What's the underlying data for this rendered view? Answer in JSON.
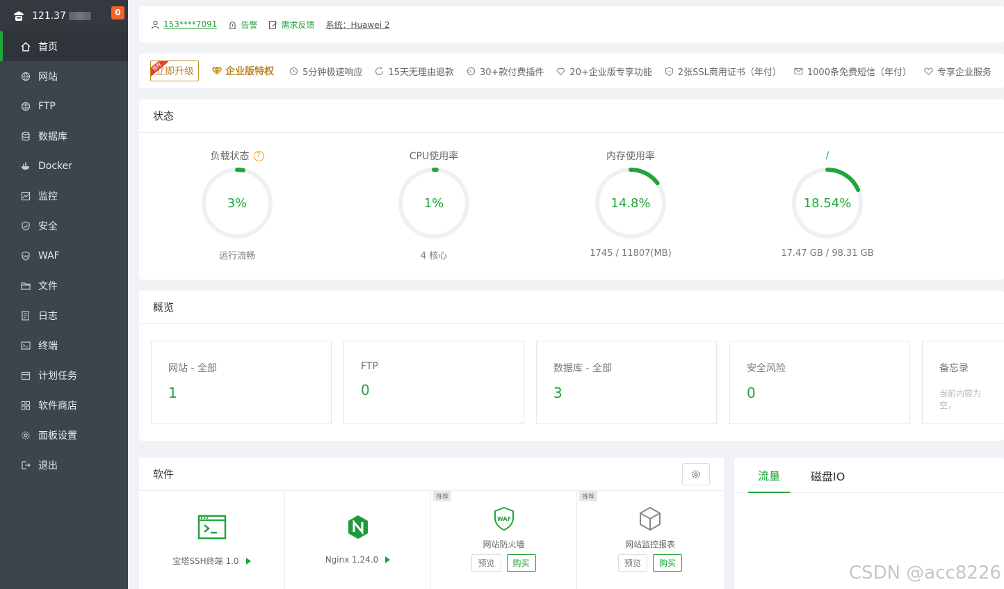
{
  "sidebar": {
    "ip": "121.37",
    "badge": "0",
    "items": [
      {
        "label": "首页",
        "icon": "home-icon"
      },
      {
        "label": "网站",
        "icon": "globe-icon"
      },
      {
        "label": "FTP",
        "icon": "ftp-icon"
      },
      {
        "label": "数据库",
        "icon": "database-icon"
      },
      {
        "label": "Docker",
        "icon": "docker-icon"
      },
      {
        "label": "监控",
        "icon": "monitor-icon"
      },
      {
        "label": "安全",
        "icon": "shield-icon"
      },
      {
        "label": "WAF",
        "icon": "waf-icon"
      },
      {
        "label": "文件",
        "icon": "folder-icon"
      },
      {
        "label": "日志",
        "icon": "log-icon"
      },
      {
        "label": "终端",
        "icon": "terminal-icon"
      },
      {
        "label": "计划任务",
        "icon": "calendar-icon"
      },
      {
        "label": "软件商店",
        "icon": "apps-icon"
      },
      {
        "label": "面板设置",
        "icon": "gear-icon"
      },
      {
        "label": "退出",
        "icon": "logout-icon"
      }
    ]
  },
  "topbar": {
    "user": "153****7091",
    "alarm": "告警",
    "feedback": "需求反馈",
    "system": "系统：Huawei 2"
  },
  "promo": {
    "ribbon": "推荐",
    "upgrade": "立即升级",
    "enterprise": "企业版特权",
    "features": [
      "5分钟极速响应",
      "15天无理由退款",
      "30+款付费插件",
      "20+企业版专享功能",
      "2张SSL商用证书（年付）",
      "1000条免费短信（年付）",
      "专享企业服务"
    ]
  },
  "status": {
    "title": "状态",
    "gauges": [
      {
        "label": "负载状态",
        "value": "3%",
        "percent": 3,
        "sub": "运行流畅"
      },
      {
        "label": "CPU使用率",
        "value": "1%",
        "percent": 1,
        "sub": "4 核心"
      },
      {
        "label": "内存使用率",
        "value": "14.8%",
        "percent": 14.8,
        "sub": "1745 / 11807(MB)"
      },
      {
        "label": "/",
        "value": "18.54%",
        "percent": 18.54,
        "sub": "17.47 GB / 98.31 GB"
      }
    ]
  },
  "overview": {
    "title": "概览",
    "cards": [
      {
        "title": "网站 - 全部",
        "value": "1"
      },
      {
        "title": "FTP",
        "value": "0"
      },
      {
        "title": "数据库 - 全部",
        "value": "3"
      },
      {
        "title": "安全风险",
        "value": "0"
      }
    ],
    "memo": {
      "title": "备忘录",
      "placeholder": "当前内容为空，"
    }
  },
  "software": {
    "title": "软件",
    "items": [
      {
        "name": "宝塔SSH终端 1.0"
      },
      {
        "name": "Nginx 1.24.0"
      },
      {
        "tag": "推荐",
        "name": "网站防火墙",
        "preview": "预览",
        "buy": "购买"
      },
      {
        "tag": "推荐",
        "name": "网站监控报表",
        "preview": "预览",
        "buy": "购买"
      }
    ]
  },
  "traffic": {
    "tabs": [
      "流量",
      "磁盘IO"
    ]
  },
  "watermark": "CSDN @acc8226",
  "colors": {
    "accent": "#20a53a",
    "sidebar": "#3c444d",
    "gold": "#b8862a"
  }
}
